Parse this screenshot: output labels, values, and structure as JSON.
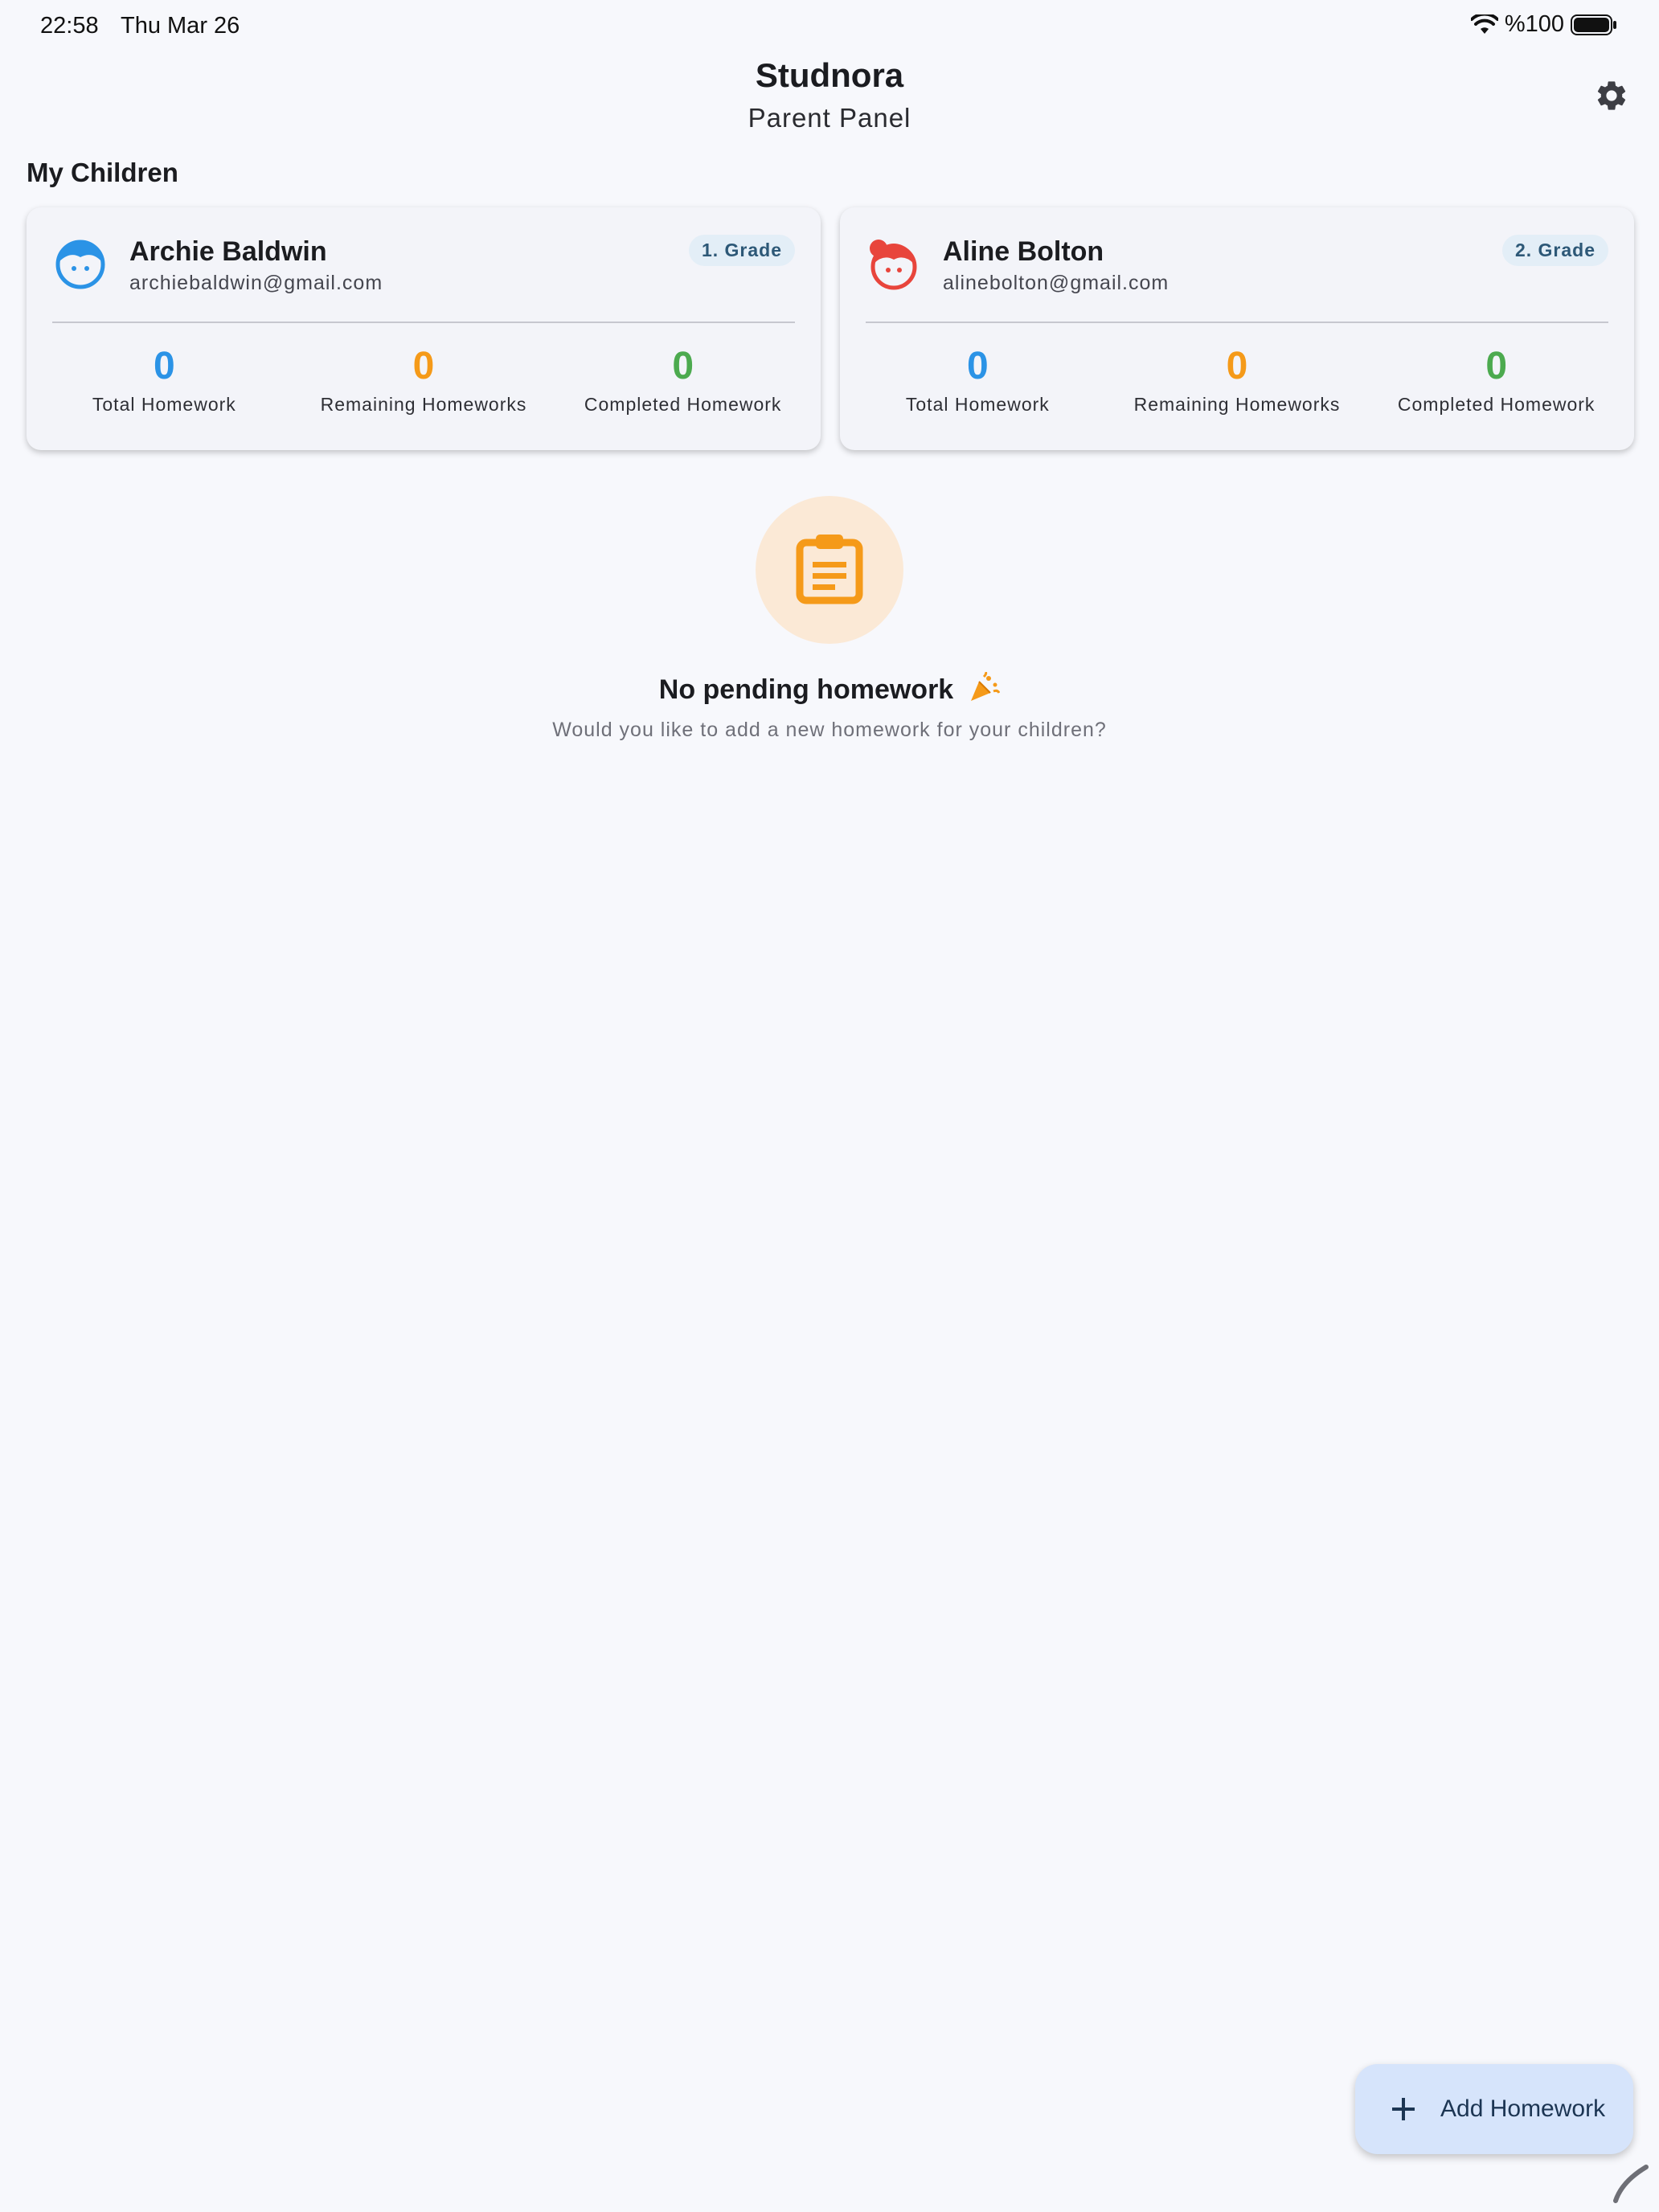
{
  "status_bar": {
    "time": "22:58",
    "date": "Thu Mar 26",
    "battery": "%100"
  },
  "header": {
    "title": "Studnora",
    "subtitle": "Parent Panel",
    "settings_icon": "gear-icon"
  },
  "section": {
    "title": "My Children"
  },
  "children": [
    {
      "name": "Archie Baldwin",
      "email": "archiebaldwin@gmail.com",
      "grade": "1. Grade",
      "avatar_icon": "boy-face-icon",
      "avatar_color": "#2b93e6",
      "stats": [
        {
          "value": "0",
          "label": "Total Homework"
        },
        {
          "value": "0",
          "label": "Remaining Homeworks"
        },
        {
          "value": "0",
          "label": "Completed Homework"
        }
      ]
    },
    {
      "name": "Aline Bolton",
      "email": "alinebolton@gmail.com",
      "grade": "2. Grade",
      "avatar_icon": "girl-face-icon",
      "avatar_color": "#e8453c",
      "stats": [
        {
          "value": "0",
          "label": "Total Homework"
        },
        {
          "value": "0",
          "label": "Remaining Homeworks"
        },
        {
          "value": "0",
          "label": "Completed Homework"
        }
      ]
    }
  ],
  "empty_state": {
    "icon": "clipboard-icon",
    "title": "No pending homework",
    "emoji": "🎉",
    "subtitle": "Would you like to add a new homework for your children?"
  },
  "fab": {
    "icon": "plus-icon",
    "label": "Add Homework"
  },
  "colors": {
    "total": "#2b93e6",
    "remaining": "#f59a19",
    "completed": "#4caa4f",
    "accent_orange": "#f59a19"
  }
}
